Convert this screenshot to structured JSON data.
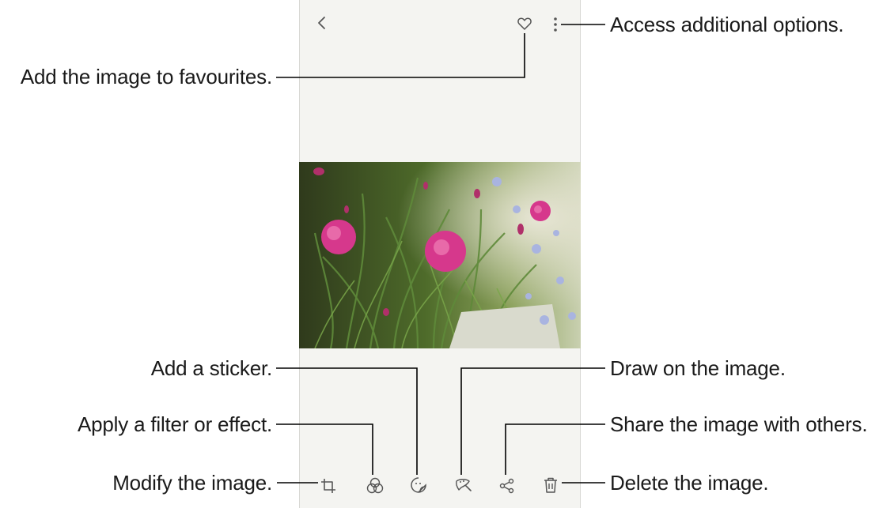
{
  "viewer": {
    "top_icons": [
      {
        "name": "back-icon",
        "icon": "chevron-left"
      },
      {
        "name": "favourite-icon",
        "icon": "heart-outline"
      },
      {
        "name": "more-options-icon",
        "icon": "vertical-ellipsis"
      }
    ],
    "bottom_icons": [
      {
        "name": "edit-icon",
        "icon": "crop-rotate"
      },
      {
        "name": "filter-icon",
        "icon": "overlapping-circles"
      },
      {
        "name": "sticker-icon",
        "icon": "sticker-face"
      },
      {
        "name": "draw-icon",
        "icon": "palette-brush"
      },
      {
        "name": "share-icon",
        "icon": "share-nodes"
      },
      {
        "name": "delete-icon",
        "icon": "trash-can"
      }
    ]
  },
  "callouts": {
    "more_options": "Access additional options.",
    "favourites": "Add the image to favourites.",
    "sticker": "Add a sticker.",
    "filter": "Apply a filter or effect.",
    "modify": "Modify the image.",
    "draw": "Draw on the image.",
    "share": "Share the image with others.",
    "delete": "Delete the image."
  },
  "colors": {
    "screen_background": "#f4f4f1",
    "icon_color": "#555555",
    "callout_line": "#000000"
  }
}
